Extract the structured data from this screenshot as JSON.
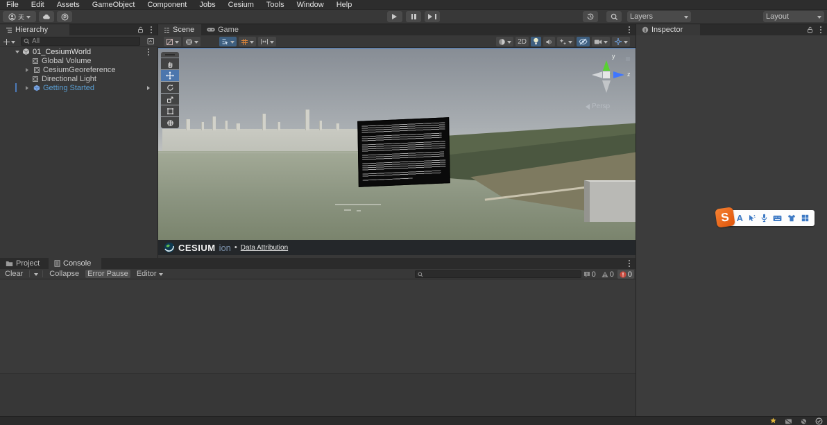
{
  "menu": {
    "items": [
      "File",
      "Edit",
      "Assets",
      "GameObject",
      "Component",
      "Jobs",
      "Cesium",
      "Tools",
      "Window",
      "Help"
    ]
  },
  "toolbar": {
    "account_glyph": "天",
    "layers": "Layers",
    "layout": "Layout"
  },
  "hierarchy": {
    "title": "Hierarchy",
    "search_placeholder": "All",
    "items": [
      {
        "label": "01_CesiumWorld"
      },
      {
        "label": "Global Volume"
      },
      {
        "label": "CesiumGeoreference"
      },
      {
        "label": "Directional Light"
      },
      {
        "label": "Getting Started"
      }
    ]
  },
  "scene": {
    "tab_scene": "Scene",
    "tab_game": "Game",
    "mode_2d": "2D",
    "gizmo": {
      "persp": "Persp",
      "axis_y": "y",
      "axis_z": "z"
    },
    "attribution": {
      "brand": "CESIUM",
      "product": "ion",
      "separator": "•",
      "link": "Data Attribution"
    }
  },
  "inspector": {
    "title": "Inspector"
  },
  "bottom": {
    "tab_project": "Project",
    "tab_console": "Console",
    "clear": "Clear",
    "collapse": "Collapse",
    "error_pause": "Error Pause",
    "editor": "Editor",
    "counters": {
      "info": "0",
      "warnings": "0",
      "errors": "0"
    }
  },
  "overlay_toolbar": {
    "logo_letter": "S",
    "text_tool": "A"
  },
  "colors": {
    "selection_blue": "#4c7ab8",
    "active_toggle_blue": "#3e5f80",
    "link_text_blue": "#5a9fd4",
    "prefab_blue": "#7aa5e2",
    "error_red": "#d13c3c",
    "grid_orange": "#d8833a",
    "recorder_orange": "#e0540a",
    "recorder_icon_blue": "#3c79c4",
    "axis_green": "#58d131",
    "axis_blue": "#3f76ff"
  }
}
